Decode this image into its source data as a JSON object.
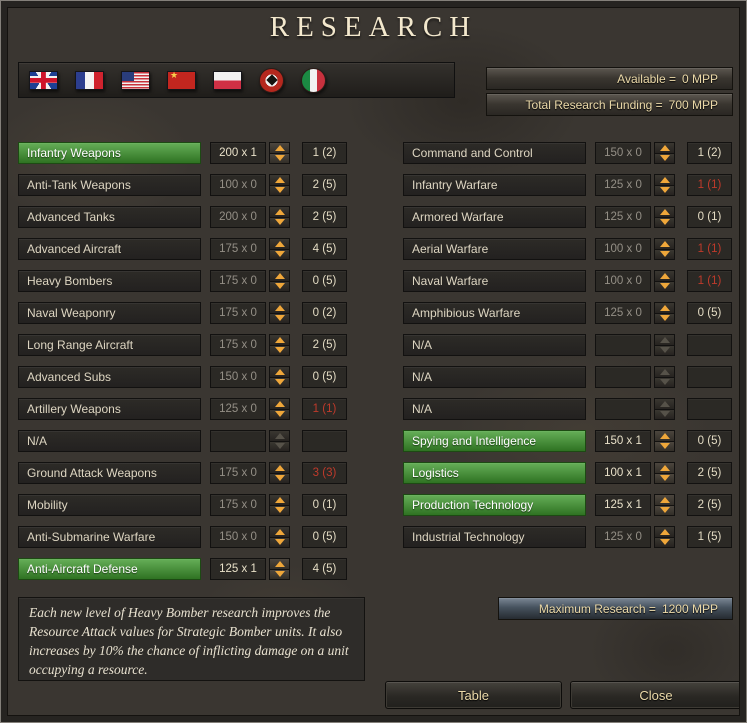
{
  "window": {
    "title": "RESEARCH"
  },
  "colors": {
    "selected_green": "#3f9a2e",
    "maxed_red": "#bf3a2b",
    "arrow_orange": "#efa73a",
    "text_cream": "#ecdaa9"
  },
  "flags": [
    {
      "name": "united-kingdom"
    },
    {
      "name": "france"
    },
    {
      "name": "usa"
    },
    {
      "name": "ussr"
    },
    {
      "name": "poland"
    },
    {
      "name": "germany"
    },
    {
      "name": "italy"
    }
  ],
  "funding": {
    "available_label": "Available =",
    "available_value": "0 MPP",
    "total_label": "Total Research Funding =",
    "total_value": "700 MPP",
    "maximum_label": "Maximum Research =",
    "maximum_value": "1200 MPP"
  },
  "research": {
    "left": [
      {
        "label": "Infantry Weapons",
        "cost": "200 x 1",
        "count": "1 (2)",
        "selected": true
      },
      {
        "label": "Anti-Tank Weapons",
        "cost": "100 x 0",
        "count": "2 (5)"
      },
      {
        "label": "Advanced Tanks",
        "cost": "200 x 0",
        "count": "2 (5)"
      },
      {
        "label": "Advanced Aircraft",
        "cost": "175 x 0",
        "count": "4 (5)"
      },
      {
        "label": "Heavy Bombers",
        "cost": "175 x 0",
        "count": "0 (5)"
      },
      {
        "label": "Naval Weaponry",
        "cost": "175 x 0",
        "count": "0 (2)"
      },
      {
        "label": "Long Range Aircraft",
        "cost": "175 x 0",
        "count": "2 (5)"
      },
      {
        "label": "Advanced Subs",
        "cost": "150 x 0",
        "count": "0 (5)"
      },
      {
        "label": "Artillery Weapons",
        "cost": "125 x 0",
        "count": "1 (1)",
        "maxed": true
      },
      {
        "label": "N/A",
        "cost": "",
        "count": "",
        "na": true
      },
      {
        "label": "Ground Attack Weapons",
        "cost": "175 x 0",
        "count": "3 (3)",
        "maxed": true
      },
      {
        "label": "Mobility",
        "cost": "175 x 0",
        "count": "0 (1)"
      },
      {
        "label": "Anti-Submarine Warfare",
        "cost": "150 x 0",
        "count": "0 (5)"
      },
      {
        "label": "Anti-Aircraft Defense",
        "cost": "125 x 1",
        "count": "4 (5)",
        "selected": true
      }
    ],
    "right": [
      {
        "label": "Command and Control",
        "cost": "150 x 0",
        "count": "1 (2)"
      },
      {
        "label": "Infantry Warfare",
        "cost": "125 x 0",
        "count": "1 (1)",
        "maxed": true
      },
      {
        "label": "Armored Warfare",
        "cost": "125 x 0",
        "count": "0 (1)"
      },
      {
        "label": "Aerial Warfare",
        "cost": "100 x 0",
        "count": "1 (1)",
        "maxed": true
      },
      {
        "label": "Naval Warfare",
        "cost": "100 x 0",
        "count": "1 (1)",
        "maxed": true
      },
      {
        "label": "Amphibious Warfare",
        "cost": "125 x 0",
        "count": "0 (5)"
      },
      {
        "label": "N/A",
        "cost": "",
        "count": "",
        "na": true
      },
      {
        "label": "N/A",
        "cost": "",
        "count": "",
        "na": true
      },
      {
        "label": "N/A",
        "cost": "",
        "count": "",
        "na": true
      },
      {
        "label": "Spying and Intelligence",
        "cost": "150 x 1",
        "count": "0 (5)",
        "selected": true
      },
      {
        "label": "Logistics",
        "cost": "100 x 1",
        "count": "2 (5)",
        "selected": true
      },
      {
        "label": "Production Technology",
        "cost": "125 x 1",
        "count": "2 (5)",
        "selected": true
      },
      {
        "label": "Industrial Technology",
        "cost": "125 x 0",
        "count": "1 (5)"
      }
    ]
  },
  "description": "Each new level of Heavy Bomber research improves the Resource Attack values for Strategic Bomber units. It also increases by 10% the chance of inflicting damage on a unit occupying a resource.",
  "buttons": {
    "table": "Table",
    "close": "Close"
  }
}
